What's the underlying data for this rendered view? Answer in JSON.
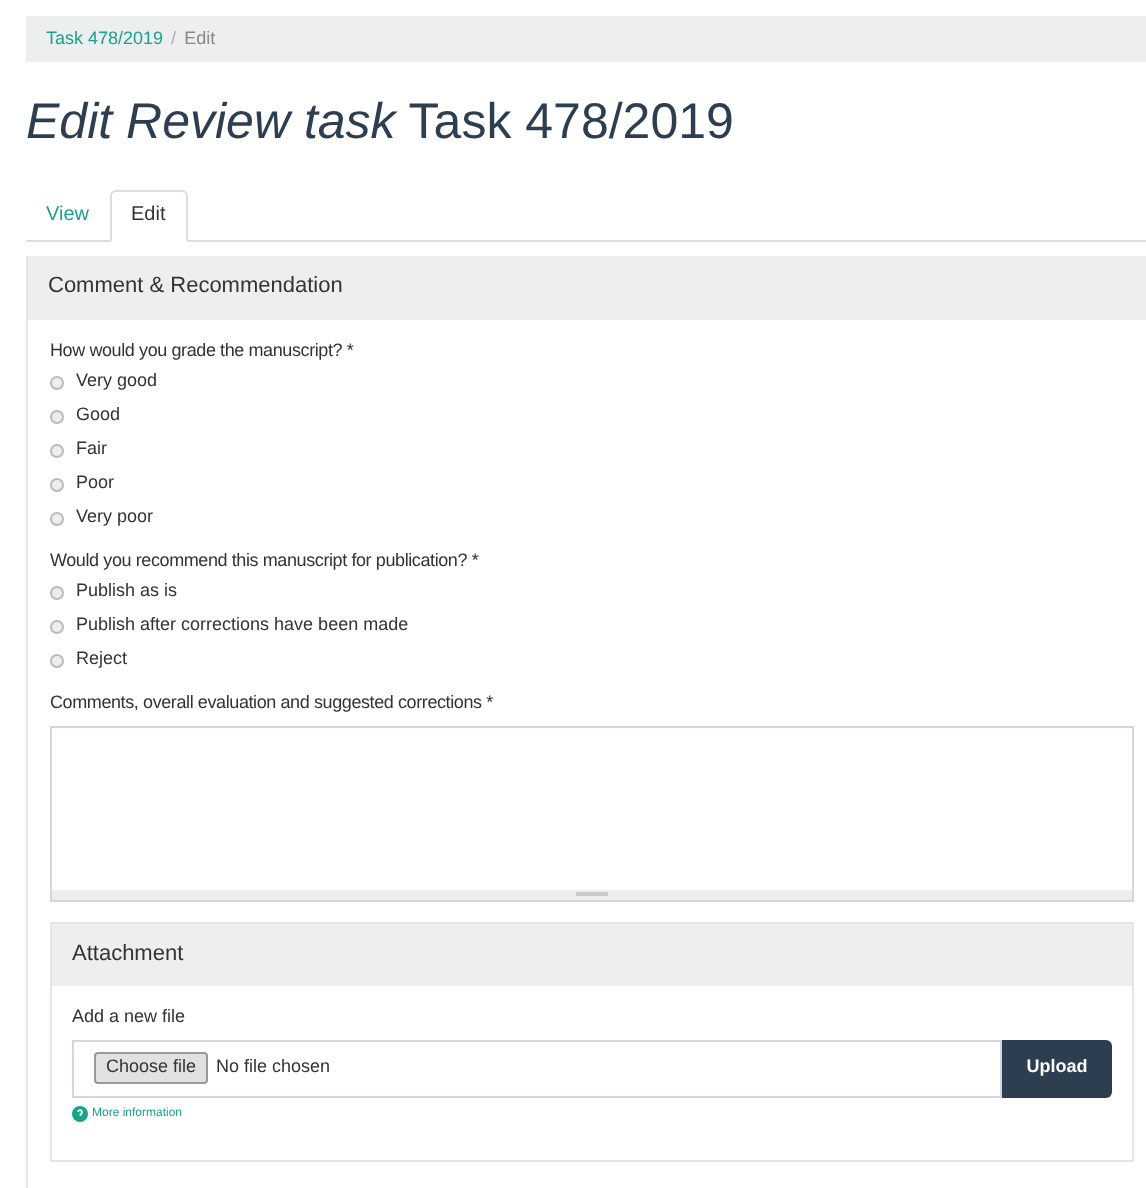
{
  "breadcrumb": [
    {
      "label": "Task 478/2019",
      "kind": "link"
    },
    {
      "label": "/",
      "kind": "separator"
    },
    {
      "label": "Edit",
      "kind": "current"
    }
  ],
  "title": {
    "italic": "Edit Review task",
    "rest": "Task 478/2019"
  },
  "tabs": [
    {
      "label": "View",
      "selected": false
    },
    {
      "label": "Edit",
      "selected": true
    }
  ],
  "panel": {
    "title": "Comment & Recommendation",
    "questions": [
      {
        "label": "How would you grade the manuscript? *",
        "options": [
          {
            "label": "Very good",
            "selected": false
          },
          {
            "label": "Good",
            "selected": false
          },
          {
            "label": "Fair",
            "selected": false
          },
          {
            "label": "Poor",
            "selected": false
          },
          {
            "label": "Very poor",
            "selected": false
          }
        ]
      },
      {
        "label": "Would you recommend this manuscript for publication? *",
        "options": [
          {
            "label": "Publish as is",
            "selected": false
          },
          {
            "label": "Publish after corrections have been made",
            "selected": false
          },
          {
            "label": "Reject",
            "selected": false
          }
        ]
      }
    ],
    "comments": {
      "label": "Comments, overall evaluation and suggested corrections *"
    },
    "attachment": {
      "title": "Attachment",
      "label": "Add a new file",
      "choose_button": "Choose file",
      "file_status": "No file chosen",
      "upload_button": "Upload",
      "help_link": "More information"
    }
  }
}
